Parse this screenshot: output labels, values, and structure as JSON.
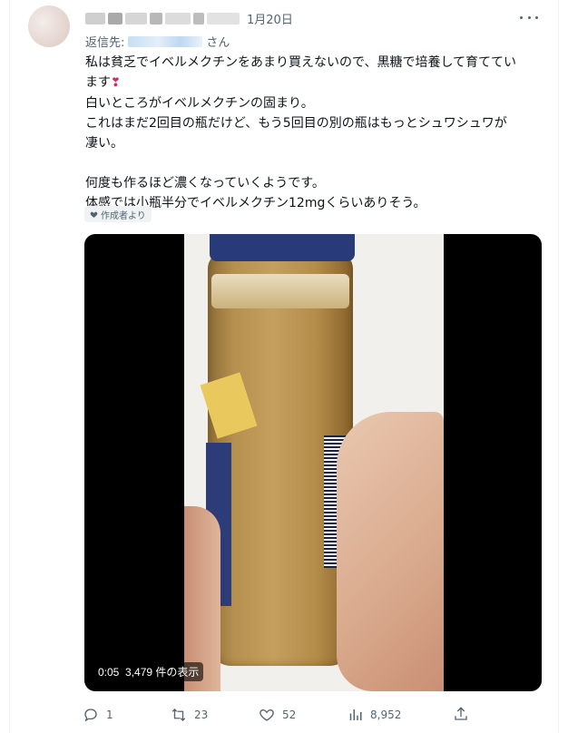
{
  "tweet": {
    "date": "1月20日",
    "reply_prefix": "返信先:",
    "reply_suffix": "さん",
    "lines": [
      "私は貧乏でイベルメクチンをあまり買えないので、黒糖で培養して育ててい",
      "ます",
      "白いところがイベルメクチンの固まり。",
      "これはまだ2回目の瓶だけど、もう5回目の別の瓶はもっとシュワシュワが",
      "凄い。",
      "何度も作るほど濃くなっていくようです。",
      "体感では小瓶半分でイベルメクチン12mgくらいありそう。"
    ],
    "heart_emoji": "❣",
    "author_badge": "作成者より"
  },
  "video": {
    "time": "0:05",
    "views": "3,479 件の表示"
  },
  "actions": {
    "replies": "1",
    "reposts": "23",
    "likes": "52",
    "views": "8,952"
  },
  "icons": {
    "more": "more-icon",
    "reply": "reply-icon",
    "repost": "repost-icon",
    "like": "heart-icon",
    "views": "analytics-icon",
    "share": "share-icon"
  },
  "colors": {
    "text": "#0f1419",
    "secondary": "#536471",
    "media_bg": "#000000"
  }
}
